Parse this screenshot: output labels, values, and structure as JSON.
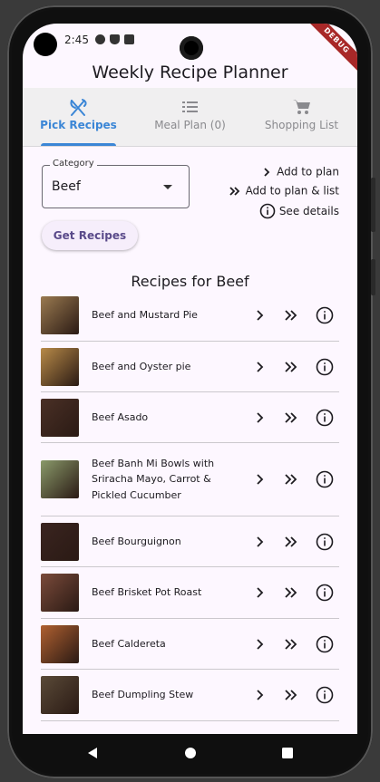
{
  "status_bar": {
    "time": "2:45",
    "debug_banner": "DEBUG"
  },
  "app": {
    "title": "Weekly Recipe Planner"
  },
  "tabs": [
    {
      "label": "Pick Recipes",
      "icon": "fork-knife-icon",
      "active": true
    },
    {
      "label": "Meal Plan (0)",
      "icon": "list-icon",
      "active": false
    },
    {
      "label": "Shopping List",
      "icon": "cart-icon",
      "active": false
    }
  ],
  "category": {
    "label": "Category",
    "value": "Beef"
  },
  "get_recipes_label": "Get Recipes",
  "legend": [
    {
      "icon": "chevron-right-icon",
      "text": "Add to plan"
    },
    {
      "icon": "double-chevron-right-icon",
      "text": "Add to plan & list"
    },
    {
      "icon": "info-icon",
      "text": "See details"
    }
  ],
  "recipes_title": "Recipes for Beef",
  "recipes": [
    {
      "name": "Beef and Mustard Pie",
      "thumb_color": "#9a7a50"
    },
    {
      "name": "Beef and Oyster pie",
      "thumb_color": "#b88a48"
    },
    {
      "name": "Beef Asado",
      "thumb_color": "#4a3026"
    },
    {
      "name": "Beef Banh Mi Bowls with Sriracha Mayo, Carrot & Pickled Cucumber",
      "thumb_color": "#8a9a6a"
    },
    {
      "name": "Beef Bourguignon",
      "thumb_color": "#3a2420"
    },
    {
      "name": "Beef Brisket Pot Roast",
      "thumb_color": "#7a4a3a"
    },
    {
      "name": "Beef Caldereta",
      "thumb_color": "#b06030"
    },
    {
      "name": "Beef Dumpling Stew",
      "thumb_color": "#5a4a38"
    }
  ]
}
